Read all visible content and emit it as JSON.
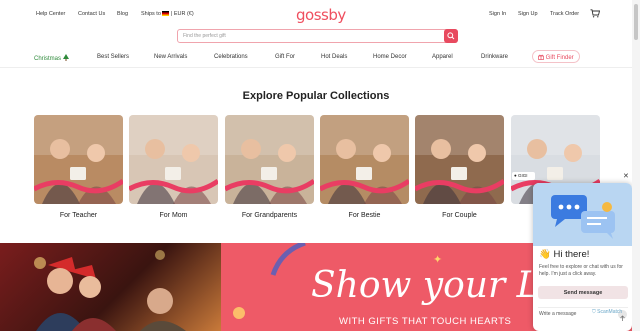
{
  "topbar": {
    "help_center": "Help Center",
    "contact_us": "Contact Us",
    "blog": "Blog",
    "ships_to": "Ships to",
    "currency": "| EUR (€)",
    "logo": "gossby",
    "sign_in": "Sign In",
    "sign_up": "Sign Up",
    "track_order": "Track Order",
    "cart_icon": "cart-icon"
  },
  "search": {
    "placeholder": "Find the perfect gift",
    "icon": "search-icon"
  },
  "nav": {
    "items": [
      "Christmas",
      "Best Sellers",
      "New Arrivals",
      "Celebrations",
      "Gift For",
      "Hot Deals",
      "Home Decor",
      "Apparel",
      "Drinkware"
    ],
    "gift_finder": "Gift Finder"
  },
  "collections": {
    "title": "Explore Popular Collections",
    "items": [
      {
        "label": "For Teacher",
        "color": "#b98b63"
      },
      {
        "label": "For Mom",
        "color": "#d8c6b5"
      },
      {
        "label": "For Grandparents",
        "color": "#c9b39a"
      },
      {
        "label": "For Bestie",
        "color": "#b58c64"
      },
      {
        "label": "For Couple",
        "color": "#8f6a4e"
      },
      {
        "label": "F",
        "color": "#d9dde2"
      }
    ]
  },
  "banner": {
    "headline": "Show your Lo",
    "subline": "WITH GIFTS    THAT TOUCH HEARTS",
    "accent": "#ee5a67"
  },
  "chat": {
    "greeting": "👋 Hi there!",
    "message": "Feel free to explore or chat with us for help. I'm just a click away.",
    "send_label": "Send message",
    "input_placeholder": "Write a message",
    "badge": "GIGI",
    "watermark": "ScanMatch"
  },
  "colors": {
    "brand": "#ef4f5f",
    "christmas": "#2e8a3b"
  }
}
